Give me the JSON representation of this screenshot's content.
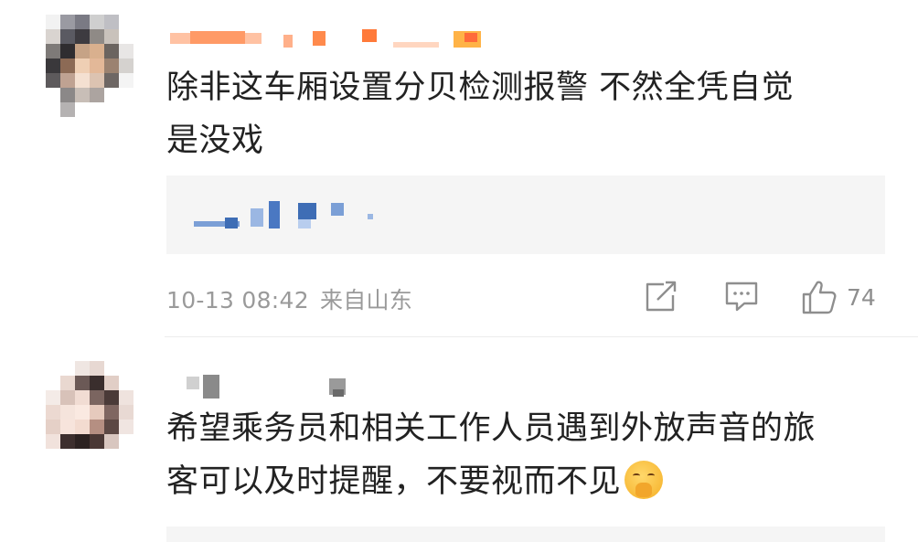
{
  "comments": [
    {
      "text_line1": "除非这车厢设置分贝检测报警 不然全凭自觉",
      "text_line2": "是没戏",
      "time": "10-13 08:42",
      "location": "来自山东",
      "like_count": "74",
      "icons": {
        "share": "share-icon",
        "comment": "comment-icon",
        "like": "thumbs-up-icon"
      }
    },
    {
      "text_line1": "希望乘务员和相关工作人员遇到外放声音的旅",
      "text_line2": "客可以及时提醒，不要视而不见",
      "emoji": "pleading-face-emoji"
    }
  ],
  "colors": {
    "text": "#222222",
    "meta": "#9a9a9a",
    "reply_background": "#f5f5f5",
    "username_redaction_orange": "#ff8a4c",
    "reply_redaction_blue": "#3e6db5"
  }
}
